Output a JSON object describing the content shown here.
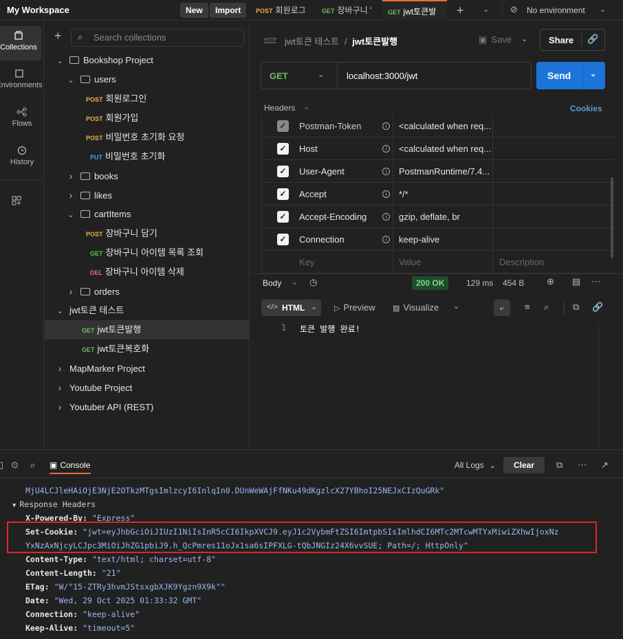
{
  "workspace": {
    "title": "My Workspace",
    "new_label": "New",
    "import_label": "Import"
  },
  "tabs": [
    {
      "method": "POST",
      "label": "회원로그"
    },
    {
      "method": "GET",
      "label": "장바구니 '"
    },
    {
      "method": "GET",
      "label": "jwt토큰발"
    }
  ],
  "environment": {
    "label": "No environment"
  },
  "rail": {
    "items": [
      {
        "label": "Collections",
        "icon": "collections-icon"
      },
      {
        "label": "Environments",
        "icon": "environments-icon"
      },
      {
        "label": "Flows",
        "icon": "flows-icon"
      },
      {
        "label": "History",
        "icon": "history-icon"
      }
    ]
  },
  "sidebar": {
    "search_placeholder": "Search collections",
    "tree": [
      {
        "label": "Bookshop Project"
      },
      {
        "label": "users"
      },
      {
        "method": "POST",
        "label": "회원로그인"
      },
      {
        "method": "POST",
        "label": "회원가입"
      },
      {
        "method": "POST",
        "label": "비밀번호 초기화 요청"
      },
      {
        "method": "PUT",
        "label": "비밀번호 초기화"
      },
      {
        "label": "books"
      },
      {
        "label": "likes"
      },
      {
        "label": "cartItems"
      },
      {
        "method": "POST",
        "label": "장바구니 담기"
      },
      {
        "method": "GET",
        "label": "장바구니 아이템 목록 조회"
      },
      {
        "method": "DEL",
        "label": "장바구니 아이템 삭제"
      },
      {
        "label": "orders"
      },
      {
        "label": "jwt토큰 테스트"
      },
      {
        "method": "GET",
        "label": "jwt토큰발행"
      },
      {
        "method": "GET",
        "label": "jwt토큰복호화"
      },
      {
        "label": "MapMarker Project"
      },
      {
        "label": "Youtube Project"
      },
      {
        "label": "Youtuber API (REST)"
      }
    ]
  },
  "request": {
    "breadcrumb_parent": "jwt토큰 테스트",
    "breadcrumb_sep": "/",
    "title": "jwt토큰발행",
    "save_label": "Save",
    "share_label": "Share",
    "method": "GET",
    "url": "localhost:3000/jwt",
    "send_label": "Send",
    "section_label": "Headers",
    "cookies_label": "Cookies",
    "headers": [
      {
        "key": "Postman-Token",
        "value": "<calculated when req...",
        "dim": true
      },
      {
        "key": "Host",
        "value": "<calculated when req..."
      },
      {
        "key": "User-Agent",
        "value": "PostmanRuntime/7.4..."
      },
      {
        "key": "Accept",
        "value": "*/*"
      },
      {
        "key": "Accept-Encoding",
        "value": "gzip, deflate, br"
      },
      {
        "key": "Connection",
        "value": "keep-alive"
      }
    ],
    "placeholder_key": "Key",
    "placeholder_value": "Value",
    "placeholder_desc": "Description"
  },
  "response": {
    "body_label": "Body",
    "status": "200 OK",
    "time": "129 ms",
    "size": "454 B",
    "format": "HTML",
    "preview_label": "Preview",
    "visualize_label": "Visualize",
    "line_no": "1",
    "line_text": "토큰 발행 완료!"
  },
  "console": {
    "title": "Console",
    "filter_label": "All Logs",
    "clear_label": "Clear",
    "lines": [
      "MjU4LCJleHAiOjE3NjE2OTkzMTgsImlzcyI6InlqIn0.DUnWeWAjFfNKu49dKgzlcX27YBhoI25NEJxCIzQuGRk\"",
      "Response Headers"
    ],
    "headers": [
      {
        "key": "X-Powered-By:",
        "value": "\"Express\""
      },
      {
        "key": "Set-Cookie:",
        "value": "\"jwt=eyJhbGciOiJIUzI1NiIsInR5cCI6IkpXVCJ9.eyJ1c2VybmFtZSI6ImtpbSIsImlhdCI6MTc2MTcwMTYxMiwiZXhwIjoxNz",
        "value2": "YxNzAxNjcyLCJpc3MiOiJhZG1pbiJ9.h_QcPmres11oJx1sa6sIPFXLG-tQbJNGIz24X6vvSUE; Path=/; HttpOnly\""
      },
      {
        "key": "Content-Type:",
        "value": "\"text/html; charset=utf-8\""
      },
      {
        "key": "Content-Length:",
        "value": "\"21\""
      },
      {
        "key": "ETag:",
        "value": "\"W/\"15-ZTRy3hvmJStsxgbXJK9Ygzn9X9k\"\""
      },
      {
        "key": "Date:",
        "value": "\"Wed, 29 Oct 2025 01:33:32 GMT\""
      },
      {
        "key": "Connection:",
        "value": "\"keep-alive\""
      },
      {
        "key": "Keep-Alive:",
        "value": "\"timeout=5\""
      }
    ]
  }
}
